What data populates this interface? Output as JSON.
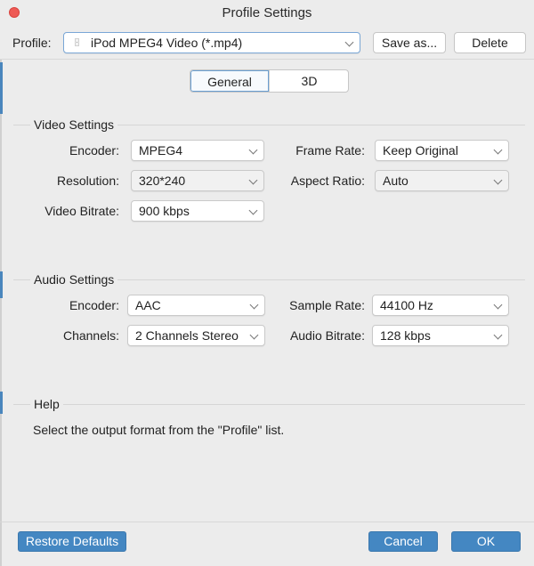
{
  "window": {
    "title": "Profile Settings"
  },
  "profile": {
    "label": "Profile:",
    "value": "iPod MPEG4 Video (*.mp4)",
    "save_as_label": "Save as...",
    "delete_label": "Delete"
  },
  "tabs": [
    {
      "label": "General",
      "selected": true
    },
    {
      "label": "3D",
      "selected": false
    }
  ],
  "video": {
    "title": "Video Settings",
    "encoder": {
      "label": "Encoder:",
      "value": "MPEG4"
    },
    "resolution": {
      "label": "Resolution:",
      "value": "320*240"
    },
    "bitrate": {
      "label": "Video Bitrate:",
      "value": "900 kbps"
    },
    "frame_rate": {
      "label": "Frame Rate:",
      "value": "Keep Original"
    },
    "aspect_ratio": {
      "label": "Aspect Ratio:",
      "value": "Auto"
    }
  },
  "audio": {
    "title": "Audio Settings",
    "encoder": {
      "label": "Encoder:",
      "value": "AAC"
    },
    "channels": {
      "label": "Channels:",
      "value": "2 Channels Stereo"
    },
    "sample_rate": {
      "label": "Sample Rate:",
      "value": "44100 Hz"
    },
    "bitrate": {
      "label": "Audio Bitrate:",
      "value": "128 kbps"
    }
  },
  "help": {
    "title": "Help",
    "text": "Select the output format from the \"Profile\" list."
  },
  "footer": {
    "restore_label": "Restore Defaults",
    "cancel_label": "Cancel",
    "ok_label": "OK"
  },
  "colors": {
    "accent": "#4487c2",
    "close": "#ee5a55",
    "background": "#ececec"
  }
}
